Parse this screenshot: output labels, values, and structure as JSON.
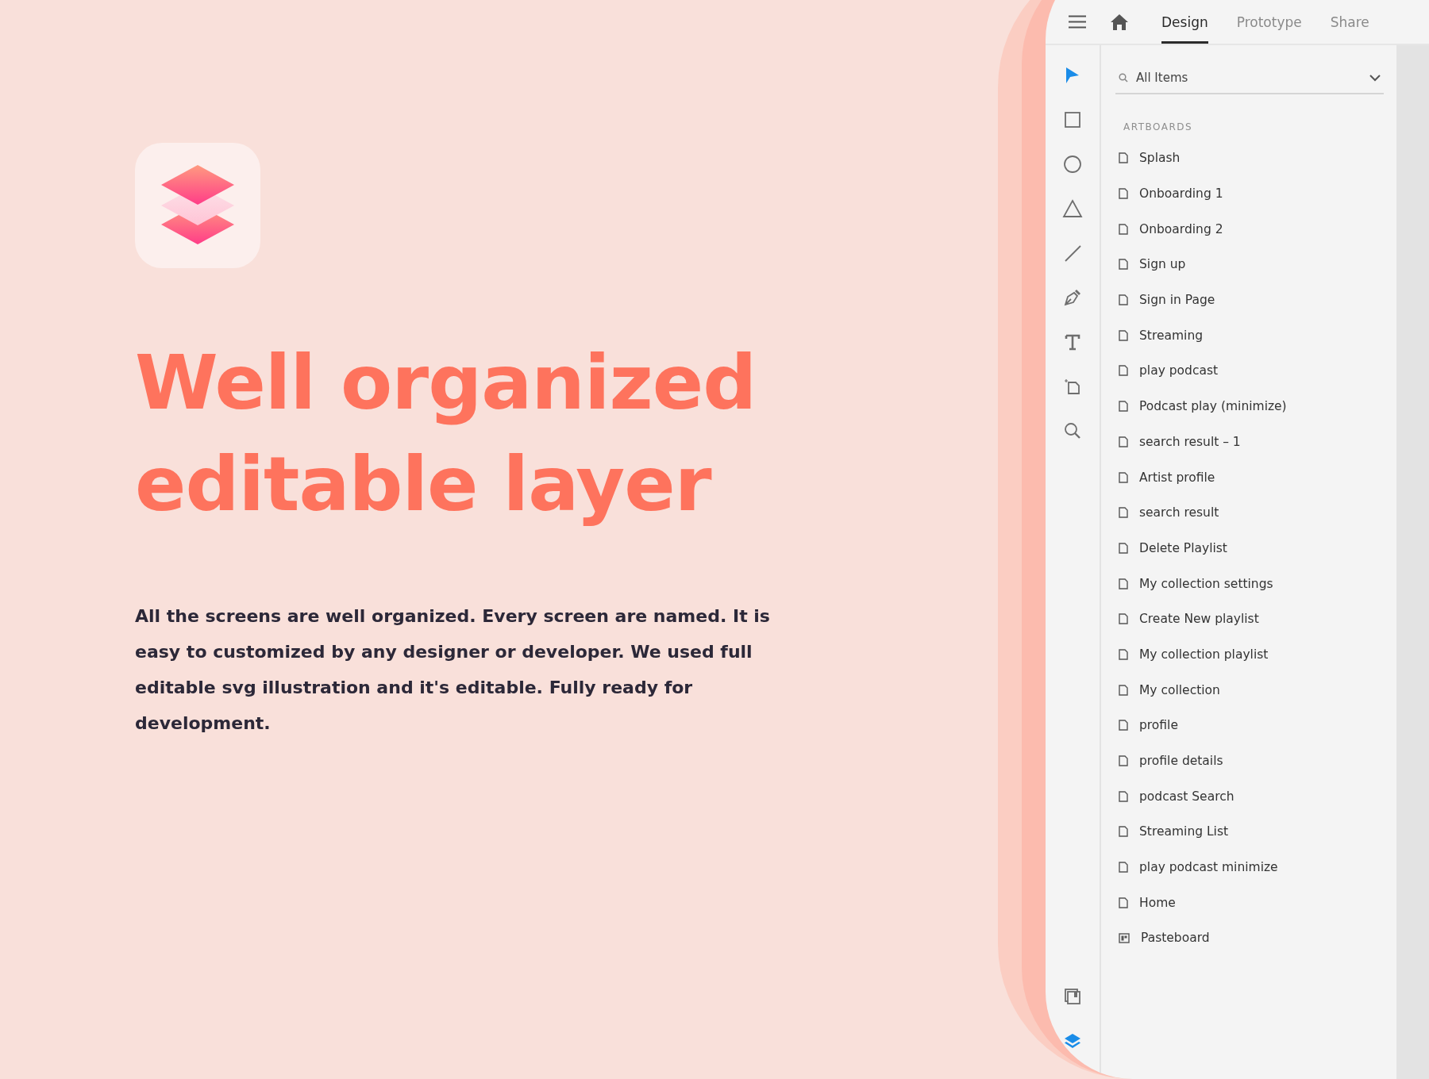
{
  "hero": {
    "title_lines": [
      "Well organized",
      "editable layer"
    ],
    "body": "All the screens are well organized. Every screen are named. It is easy to customized by any designer or developer. We used full editable svg illustration and it's editable. Fully ready for development."
  },
  "app": {
    "tabs": [
      {
        "label": "Design",
        "selected": true
      },
      {
        "label": "Prototype",
        "selected": false
      },
      {
        "label": "Share",
        "selected": false
      }
    ],
    "tools": [
      {
        "kind": "select",
        "selected": true
      },
      {
        "kind": "rectangle",
        "selected": false
      },
      {
        "kind": "ellipse",
        "selected": false
      },
      {
        "kind": "polygon",
        "selected": false
      },
      {
        "kind": "line",
        "selected": false
      },
      {
        "kind": "pen",
        "selected": false
      },
      {
        "kind": "text",
        "selected": false
      },
      {
        "kind": "artboard",
        "selected": false
      },
      {
        "kind": "zoom",
        "selected": false
      }
    ],
    "bottom_tools": [
      {
        "kind": "assets",
        "selected": false
      },
      {
        "kind": "layers",
        "selected": true
      }
    ],
    "search": {
      "value": "All Items"
    },
    "section": "ARTBOARDS",
    "items": [
      {
        "kind": "artboard",
        "label": "Splash"
      },
      {
        "kind": "artboard",
        "label": "Onboarding 1"
      },
      {
        "kind": "artboard",
        "label": "Onboarding 2"
      },
      {
        "kind": "artboard",
        "label": "Sign up"
      },
      {
        "kind": "artboard",
        "label": "Sign in Page"
      },
      {
        "kind": "artboard",
        "label": "Streaming"
      },
      {
        "kind": "artboard",
        "label": "play podcast"
      },
      {
        "kind": "artboard",
        "label": "Podcast play (minimize)"
      },
      {
        "kind": "artboard",
        "label": "search result – 1"
      },
      {
        "kind": "artboard",
        "label": "Artist profile"
      },
      {
        "kind": "artboard",
        "label": "search result"
      },
      {
        "kind": "artboard",
        "label": "Delete Playlist"
      },
      {
        "kind": "artboard",
        "label": "My collection settings"
      },
      {
        "kind": "artboard",
        "label": "Create New playlist"
      },
      {
        "kind": "artboard",
        "label": "My collection playlist"
      },
      {
        "kind": "artboard",
        "label": "My collection"
      },
      {
        "kind": "artboard",
        "label": "profile"
      },
      {
        "kind": "artboard",
        "label": "profile details"
      },
      {
        "kind": "artboard",
        "label": "podcast Search"
      },
      {
        "kind": "artboard",
        "label": "Streaming List"
      },
      {
        "kind": "artboard",
        "label": "play podcast minimize"
      },
      {
        "kind": "artboard",
        "label": "Home"
      },
      {
        "kind": "pasteboard",
        "label": "Pasteboard"
      }
    ]
  }
}
